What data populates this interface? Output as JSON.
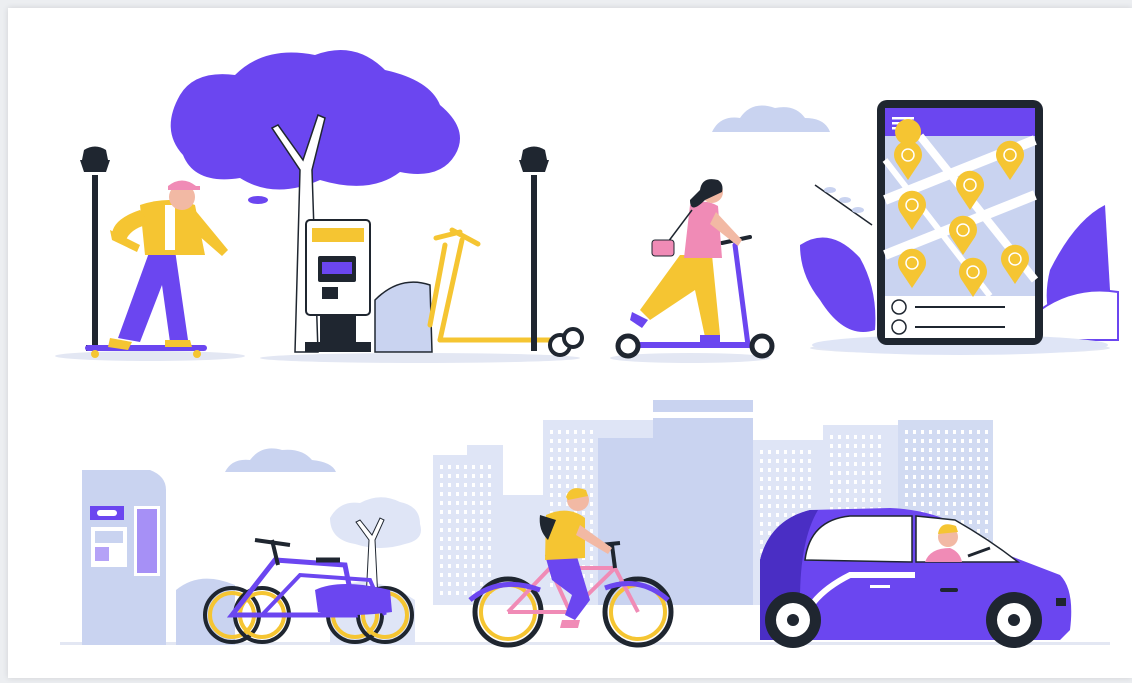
{
  "colors": {
    "accent": "#6b46f0",
    "accent_dark": "#4a2ec4",
    "yellow": "#f5c532",
    "light_blue": "#c9d3f0",
    "pale_blue": "#dfe5f6",
    "dark": "#1f2630",
    "pink": "#f08bb6",
    "skin": "#f2b9a4",
    "white": "#ffffff"
  },
  "icons": [
    "lamp-post-icon",
    "tree-icon",
    "cloud-icon",
    "map-pin-icon",
    "menu-icon",
    "bike-icon",
    "scooter-icon"
  ]
}
